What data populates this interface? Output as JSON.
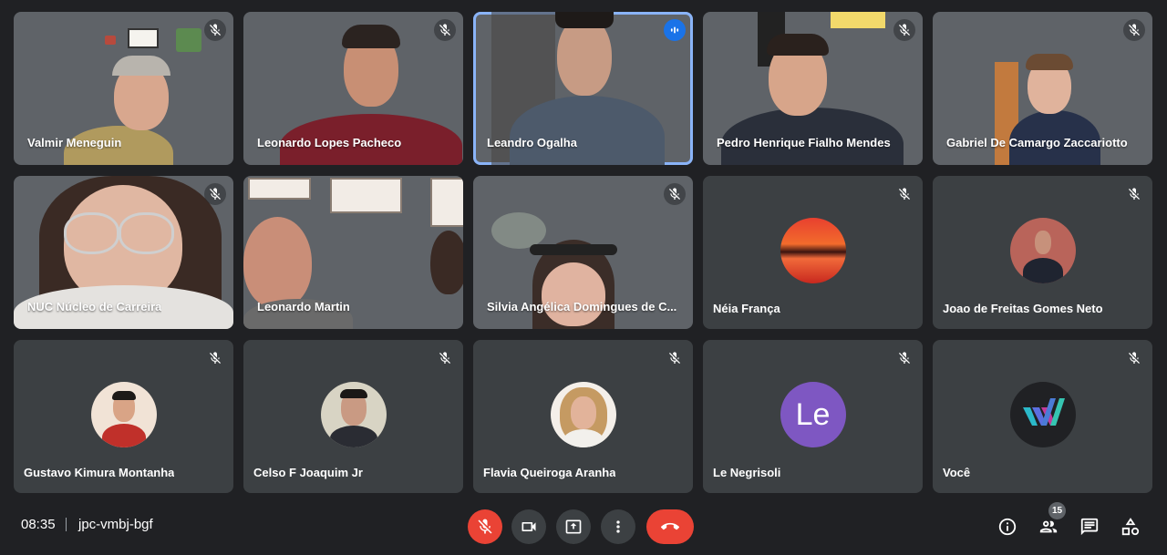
{
  "meeting": {
    "time": "08:35",
    "code": "jpc-vmbj-bgf",
    "participant_count": "15"
  },
  "tiles": [
    {
      "name": "Valmir Meneguin",
      "video": true
    },
    {
      "name": "Leonardo Lopes Pacheco",
      "video": true
    },
    {
      "name": "Leandro Ogalha",
      "video": true,
      "speaking": true
    },
    {
      "name": "Pedro Henrique Fialho Mendes",
      "video": true
    },
    {
      "name": "Gabriel De Camargo Zaccariotto",
      "video": true
    },
    {
      "name": "NUC Núcleo de Carreira",
      "video": true
    },
    {
      "name": "Leonardo Martin",
      "video": true
    },
    {
      "name": "Silvia Angélica Domingues de C...",
      "video": true
    },
    {
      "name": "Néia França",
      "video": false
    },
    {
      "name": "Joao de Freitas Gomes Neto",
      "video": false
    },
    {
      "name": "Gustavo Kimura Montanha",
      "video": false
    },
    {
      "name": "Celso F Joaquim Jr",
      "video": false
    },
    {
      "name": "Flavia Queiroga Aranha",
      "video": false
    },
    {
      "name": "Le Negrisoli",
      "video": false,
      "initials": "Le"
    },
    {
      "name": "Você",
      "video": false
    }
  ],
  "icons": {
    "muted": "mic-off-icon",
    "speaking": "audio-level-icon",
    "controls": [
      "mic-off-icon",
      "camera-icon",
      "present-icon",
      "more-vert-icon",
      "call-end-icon"
    ],
    "side": [
      "info-icon",
      "people-icon",
      "chat-icon",
      "activities-icon"
    ]
  },
  "colors": {
    "background": "#202124",
    "tile": "#3c4043",
    "speaking_border": "#8ab4f8",
    "danger": "#ea4335",
    "avatar_le": "#7e57c2"
  }
}
